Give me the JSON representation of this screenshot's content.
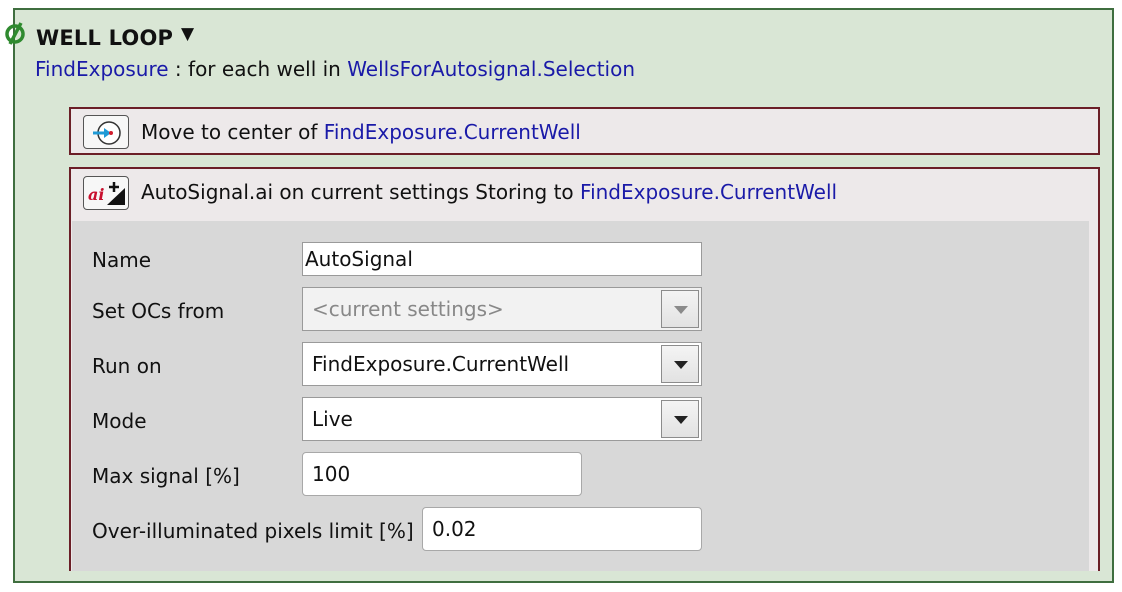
{
  "loop": {
    "title": "WELL LOOP",
    "collapse_arrow": "▼",
    "variable": "FindExposure",
    "mid_text": " : for each well in ",
    "collection": "WellsForAutosignal.Selection"
  },
  "move_block": {
    "icon": "move-to-center-icon",
    "prefix": "Move to center of ",
    "target": "FindExposure.CurrentWell"
  },
  "autosignal_block": {
    "icon": "ai-autosignal-icon",
    "prefix": "AutoSignal.ai on current settings Storing to ",
    "target": "FindExposure.CurrentWell",
    "fields": {
      "name": {
        "label": "Name",
        "value": "AutoSignal"
      },
      "set_ocs": {
        "label": "Set OCs from",
        "placeholder": "<current settings>"
      },
      "run_on": {
        "label": "Run on",
        "value": "FindExposure.CurrentWell"
      },
      "mode": {
        "label": "Mode",
        "value": "Live"
      },
      "max_signal": {
        "label": "Max signal [%]",
        "value": "100"
      },
      "overillum": {
        "label": "Over-illuminated pixels limit [%]",
        "value": "0.02"
      }
    }
  },
  "colors": {
    "loop_bg": "#d9e6d5",
    "loop_border": "#3f6e3f",
    "block_border": "#6b1f27",
    "link": "#1a1aa8"
  }
}
